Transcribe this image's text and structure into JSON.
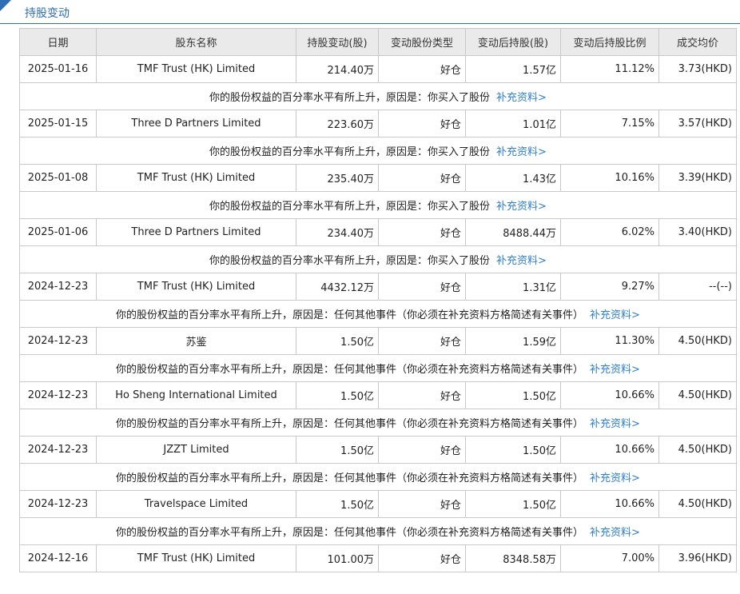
{
  "section": {
    "title": "持股变动"
  },
  "table": {
    "headers": [
      "日期",
      "股东名称",
      "持股变动(股)",
      "变动股份类型",
      "变动后持股(股)",
      "变动后持股比例",
      "成交均价"
    ],
    "rows": [
      {
        "date": "2025-01-16",
        "holder": "TMF Trust (HK) Limited",
        "change": "214.40万",
        "type": "好仓",
        "after": "1.57亿",
        "ratio": "11.12%",
        "price": "3.73(HKD)",
        "note": "你的股份权益的百分率水平有所上升，原因是：你买入了股份",
        "link": "补充资料>"
      },
      {
        "date": "2025-01-15",
        "holder": "Three D Partners Limited",
        "change": "223.60万",
        "type": "好仓",
        "after": "1.01亿",
        "ratio": "7.15%",
        "price": "3.57(HKD)",
        "note": "你的股份权益的百分率水平有所上升，原因是：你买入了股份",
        "link": "补充资料>"
      },
      {
        "date": "2025-01-08",
        "holder": "TMF Trust (HK) Limited",
        "change": "235.40万",
        "type": "好仓",
        "after": "1.43亿",
        "ratio": "10.16%",
        "price": "3.39(HKD)",
        "note": "你的股份权益的百分率水平有所上升，原因是：你买入了股份",
        "link": "补充资料>"
      },
      {
        "date": "2025-01-06",
        "holder": "Three D Partners Limited",
        "change": "234.40万",
        "type": "好仓",
        "after": "8488.44万",
        "ratio": "6.02%",
        "price": "3.40(HKD)",
        "note": "你的股份权益的百分率水平有所上升，原因是：你买入了股份",
        "link": "补充资料>"
      },
      {
        "date": "2024-12-23",
        "holder": "TMF Trust (HK) Limited",
        "change": "4432.12万",
        "type": "好仓",
        "after": "1.31亿",
        "ratio": "9.27%",
        "price": "--(--)",
        "note": "你的股份权益的百分率水平有所上升，原因是：任何其他事件（你必须在补充资料方格简述有关事件）",
        "link": "补充资料>"
      },
      {
        "date": "2024-12-23",
        "holder": "苏鉴",
        "change": "1.50亿",
        "type": "好仓",
        "after": "1.59亿",
        "ratio": "11.30%",
        "price": "4.50(HKD)",
        "note": "你的股份权益的百分率水平有所上升，原因是：任何其他事件（你必须在补充资料方格简述有关事件）",
        "link": "补充资料>"
      },
      {
        "date": "2024-12-23",
        "holder": "Ho Sheng International Limited",
        "change": "1.50亿",
        "type": "好仓",
        "after": "1.50亿",
        "ratio": "10.66%",
        "price": "4.50(HKD)",
        "note": "你的股份权益的百分率水平有所上升，原因是：任何其他事件（你必须在补充资料方格简述有关事件）",
        "link": "补充资料>"
      },
      {
        "date": "2024-12-23",
        "holder": "JZZT Limited",
        "change": "1.50亿",
        "type": "好仓",
        "after": "1.50亿",
        "ratio": "10.66%",
        "price": "4.50(HKD)",
        "note": "你的股份权益的百分率水平有所上升，原因是：任何其他事件（你必须在补充资料方格简述有关事件）",
        "link": "补充资料>"
      },
      {
        "date": "2024-12-23",
        "holder": "Travelspace Limited",
        "change": "1.50亿",
        "type": "好仓",
        "after": "1.50亿",
        "ratio": "10.66%",
        "price": "4.50(HKD)",
        "note": "你的股份权益的百分率水平有所上升，原因是：任何其他事件（你必须在补充资料方格简述有关事件）",
        "link": "补充资料>"
      },
      {
        "date": "2024-12-16",
        "holder": "TMF Trust (HK) Limited",
        "change": "101.00万",
        "type": "好仓",
        "after": "8348.58万",
        "ratio": "7.00%",
        "price": "3.96(HKD)",
        "note": "",
        "link": ""
      }
    ]
  }
}
